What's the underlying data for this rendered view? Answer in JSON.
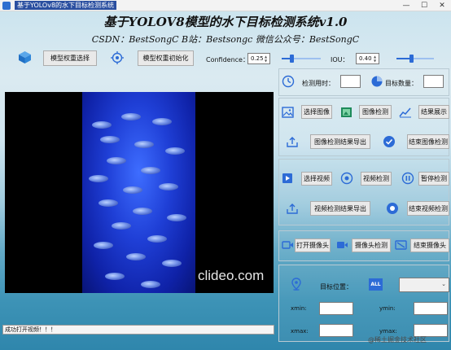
{
  "window": {
    "title": "基于YOLOv8的水下目标检测系统",
    "controls": [
      "—",
      "☐",
      "✕"
    ]
  },
  "header": {
    "title": "基于YOLOV8模型的水下目标检测系统v1.0",
    "subtitle": "CSDN：BestSongC   B站：Bestsongc   微信公众号：BestSongC"
  },
  "toolbar": {
    "select_weights": "模型权重选择",
    "init_weights": "模型权重初始化",
    "confidence_label": "Confidence：",
    "confidence_value": "0.25",
    "confidence_level": 0.25,
    "iou_label": "IOU：",
    "iou_value": "0.40",
    "iou_level": 0.4
  },
  "stats": {
    "time_label": "检测用时：",
    "time_value": "",
    "count_label": "目标数量：",
    "count_value": ""
  },
  "image_section": {
    "select_image": "选择图像",
    "detect_image": "图像检测",
    "show_result": "结果展示",
    "export_image_result": "图像检测结果导出",
    "end_image_detect": "结束图像检测"
  },
  "video_section": {
    "select_video": "选择视频",
    "detect_video": "视频检测",
    "pause_detect": "暂停检测",
    "export_video_result": "视频检测结果导出",
    "end_video_detect": "结束视频检测"
  },
  "camera_section": {
    "open_camera": "打开摄像头",
    "camera_detect": "摄像头检测",
    "close_camera": "结束摄像头"
  },
  "position_section": {
    "target_position_label": "目标位置：",
    "target_select_value": "",
    "all_badge": "ALL",
    "xmin_label": "xmin:",
    "xmin_value": "",
    "ymin_label": "ymin:",
    "ymin_value": "",
    "xmax_label": "xmax:",
    "xmax_value": "",
    "ymax_label": "ymax:",
    "ymax_value": ""
  },
  "video": {
    "watermark": "clideo.com"
  },
  "status": {
    "message": "成功打开视频！！！"
  },
  "footer": {
    "watermark": "@稀土掘金技术社区"
  },
  "colors": {
    "accent": "#2c6bd6",
    "panel_border": "#b8cad3",
    "video_bg": "#000000"
  }
}
